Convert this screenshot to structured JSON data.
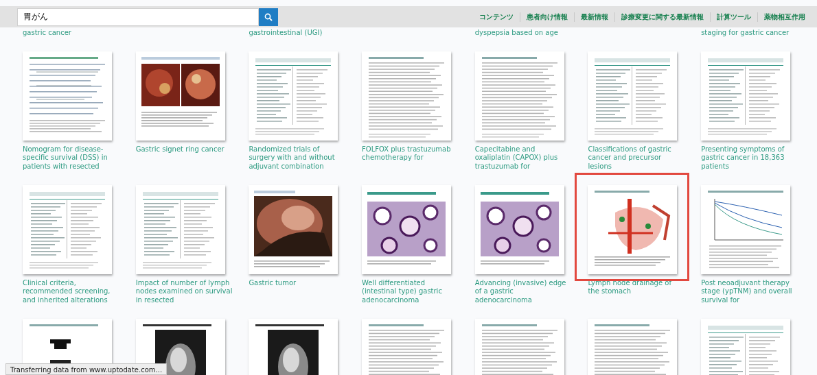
{
  "search": {
    "value": "胃がん"
  },
  "nav": [
    "コンテンツ",
    "患者向け情報",
    "最新情報",
    "診療変更に関する最新情報",
    "計算ツール",
    "薬物相互作用"
  ],
  "partial_row": [
    {
      "kind": "text",
      "caption": "gastric cancer"
    },
    {
      "kind": "blank"
    },
    {
      "kind": "text",
      "caption": "gastrointestinal (UGI)"
    },
    {
      "kind": "blank"
    },
    {
      "kind": "text",
      "caption": "dyspepsia based on age"
    },
    {
      "kind": "blank"
    },
    {
      "kind": "text",
      "caption": "staging for gastric cancer"
    }
  ],
  "rows": [
    {
      "items": [
        {
          "kind": "chart",
          "caption": "Nomogram for disease-specific survival (DSS) in patients with resected",
          "selected": false
        },
        {
          "kind": "photos",
          "caption": "Gastric signet ring cancer",
          "selected": false
        },
        {
          "kind": "table",
          "caption": "Randomized trials of surgery with and without adjuvant combination",
          "selected": false
        },
        {
          "kind": "document",
          "caption": "FOLFOX plus trastuzumab chemotherapy for",
          "selected": false
        },
        {
          "kind": "document",
          "caption": "Capecitabine and oxaliplatin (CAPOX) plus trastuzumab for",
          "selected": false
        },
        {
          "kind": "table",
          "caption": "Classifications of gastric cancer and precursor lesions",
          "selected": false
        },
        {
          "kind": "table",
          "caption": "Presenting symptoms of gastric cancer in 18,363 patients",
          "selected": false
        }
      ]
    },
    {
      "items": [
        {
          "kind": "table",
          "caption": "Clinical criteria, recommended screening, and inherited alterations",
          "selected": false
        },
        {
          "kind": "table",
          "caption": "Impact of number of lymph nodes examined on survival in resected",
          "selected": false
        },
        {
          "kind": "photo",
          "caption": "Gastric tumor",
          "selected": false
        },
        {
          "kind": "histology",
          "caption": "Well differentiated (intestinal type) gastric adenocarcinoma",
          "selected": false
        },
        {
          "kind": "histology",
          "caption": "Advancing (invasive) edge of a gastric adenocarcinoma",
          "selected": false
        },
        {
          "kind": "anatomy",
          "caption": "Lymph node drainage of the stomach",
          "selected": true
        },
        {
          "kind": "curves",
          "caption": "Post neoadjuvant therapy stage (ypTNM) and overall survival for",
          "selected": false
        }
      ]
    },
    {
      "items": [
        {
          "kind": "diagram",
          "selected": false
        },
        {
          "kind": "xray",
          "selected": false
        },
        {
          "kind": "xray",
          "selected": false
        },
        {
          "kind": "document",
          "selected": false
        },
        {
          "kind": "document",
          "selected": false
        },
        {
          "kind": "document",
          "selected": false
        },
        {
          "kind": "table",
          "selected": false
        }
      ]
    }
  ],
  "status_bar": "Transferring data from www.uptodate.com..."
}
